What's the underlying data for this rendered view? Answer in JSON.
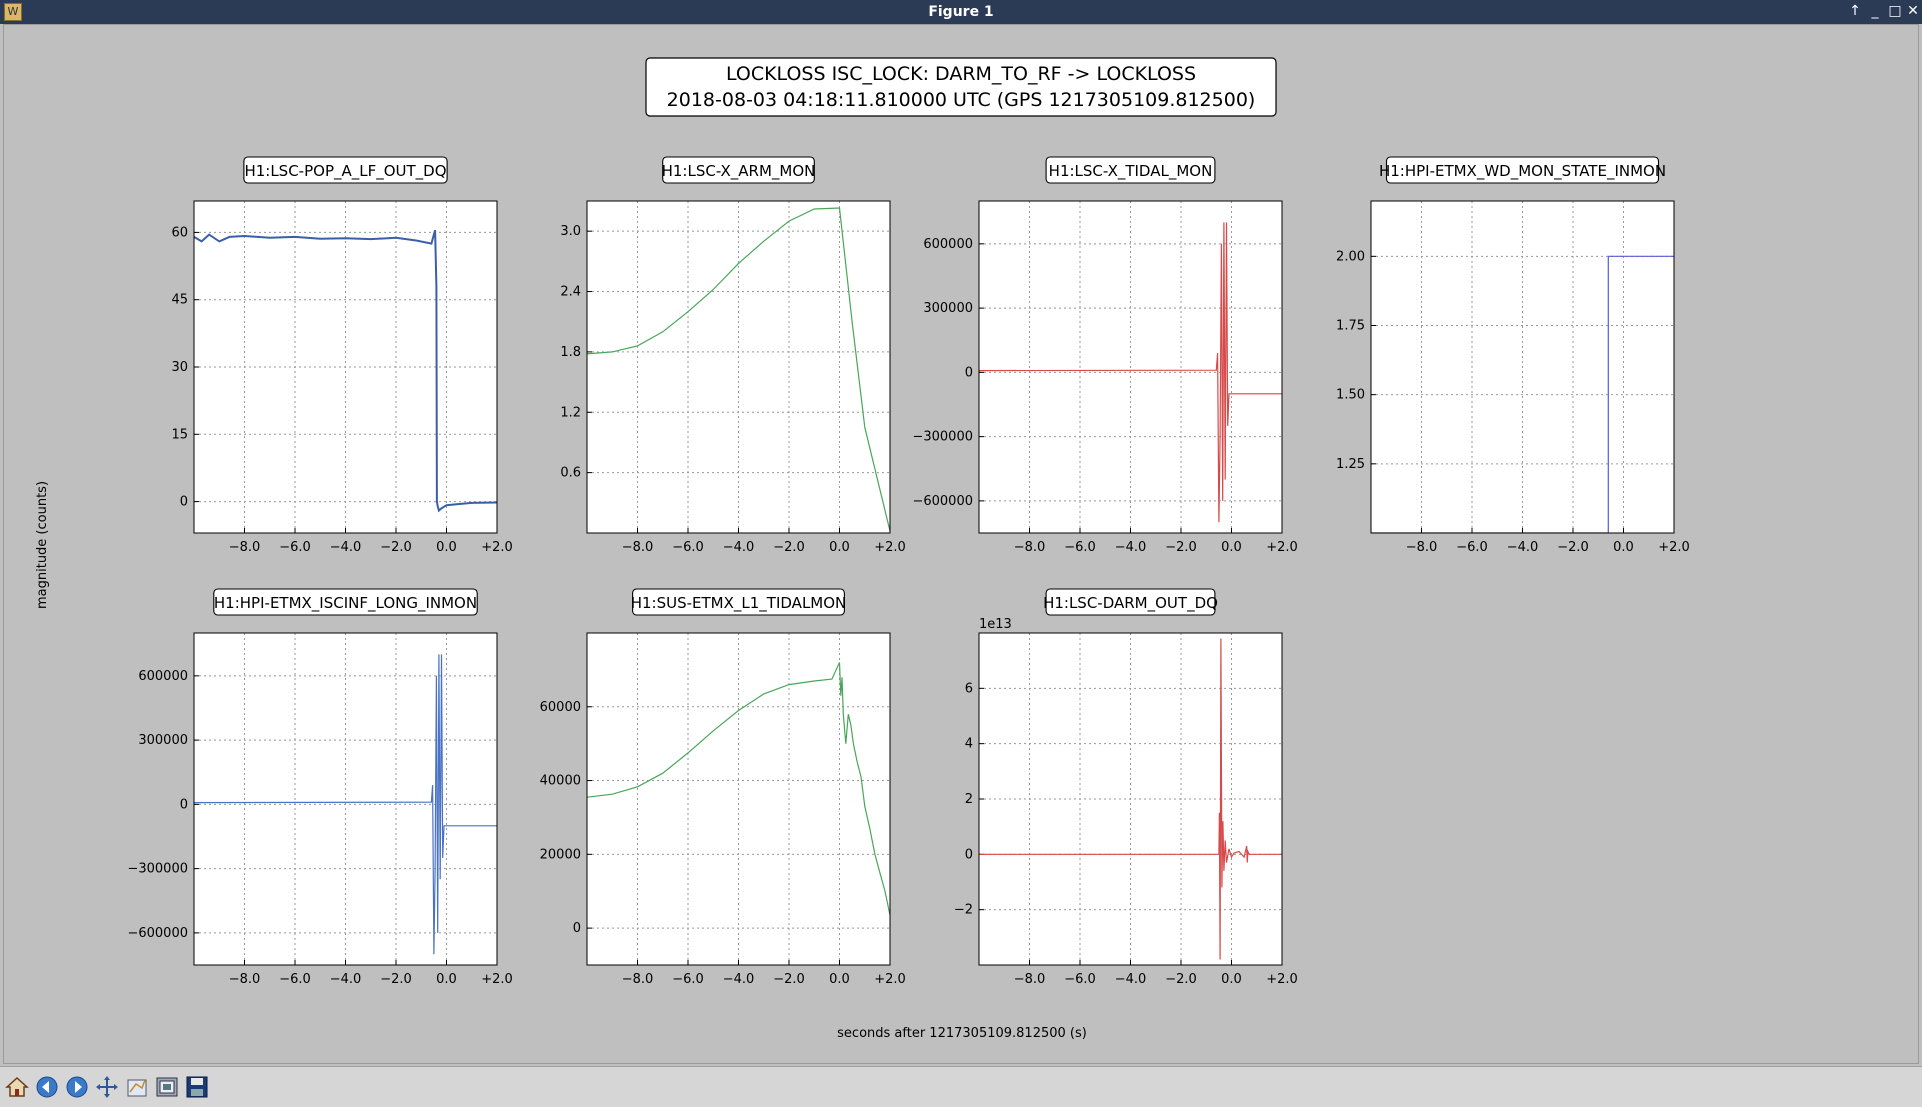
{
  "window": {
    "title": "Figure 1",
    "app_icon": "matplotlib-icon",
    "controls": [
      "up-arrow-icon",
      "minimize-icon",
      "maximize-icon",
      "close-icon"
    ]
  },
  "figure": {
    "title_line1": "LOCKLOSS ISC_LOCK: DARM_TO_RF -> LOCKLOSS",
    "title_line2": "2018-08-03 04:18:11.810000 UTC (GPS 1217305109.812500)",
    "ylabel": "magnitude (counts)",
    "xlabel": "seconds after 1217305109.812500 (s)"
  },
  "toolbar": {
    "buttons": [
      "home-icon",
      "back-icon",
      "forward-icon",
      "pan-icon",
      "configure-subplots-icon",
      "zoom-icon",
      "save-icon"
    ]
  },
  "chart_data": [
    {
      "type": "line",
      "title": "H1:LSC-POP_A_LF_OUT_DQ",
      "color": "#3a5fa8",
      "xlim": [
        -10,
        2
      ],
      "ylim": [
        -7,
        67
      ],
      "xticks": [
        "−8.0",
        "−6.0",
        "−4.0",
        "−2.0",
        "0.0",
        "+2.0"
      ],
      "yticks": [
        {
          "v": 60,
          "t": "60"
        },
        {
          "v": 45,
          "t": "45"
        },
        {
          "v": 30,
          "t": "30"
        },
        {
          "v": 15,
          "t": "15"
        },
        {
          "v": 0,
          "t": "0"
        }
      ],
      "series": [
        {
          "x": [
            -10,
            -9.7,
            -9.4,
            -9.0,
            -8.6,
            -8.0,
            -7.0,
            -6.0,
            -5.0,
            -4.0,
            -3.0,
            -2.0,
            -1.2,
            -0.6,
            -0.45,
            -0.4,
            -0.38,
            -0.35,
            -0.3,
            -0.2,
            0,
            0.4,
            1.0,
            2.0
          ],
          "y": [
            59,
            58,
            59.5,
            58,
            59,
            59.2,
            58.8,
            59,
            58.6,
            58.7,
            58.5,
            58.8,
            58.2,
            57.5,
            60.5,
            48,
            0,
            -1,
            -2,
            -1.5,
            -0.8,
            -0.6,
            -0.3,
            -0.2
          ]
        }
      ]
    },
    {
      "type": "line",
      "title": "H1:LSC-X_ARM_MON",
      "color": "#4aa55a",
      "xlim": [
        -10,
        2
      ],
      "ylim": [
        0,
        3.3
      ],
      "xticks": [
        "−8.0",
        "−6.0",
        "−4.0",
        "−2.0",
        "0.0",
        "+2.0"
      ],
      "yticks": [
        {
          "v": 3.0,
          "t": "3.0"
        },
        {
          "v": 2.4,
          "t": "2.4"
        },
        {
          "v": 1.8,
          "t": "1.8"
        },
        {
          "v": 1.2,
          "t": "1.2"
        },
        {
          "v": 0.6,
          "t": "0.6"
        }
      ],
      "series": [
        {
          "x": [
            -10,
            -9,
            -8,
            -7,
            -6,
            -5,
            -4,
            -3,
            -2,
            -1,
            0,
            0.5,
            1,
            2
          ],
          "y": [
            1.78,
            1.8,
            1.86,
            2.0,
            2.2,
            2.42,
            2.68,
            2.9,
            3.1,
            3.22,
            3.23,
            2.1,
            1.05,
            0.02
          ]
        }
      ]
    },
    {
      "type": "line",
      "title": "H1:LSC-X_TIDAL_MON",
      "color": "#d64a4a",
      "xlim": [
        -10,
        2
      ],
      "ylim": [
        -750000,
        800000
      ],
      "xticks": [
        "−8.0",
        "−6.0",
        "−4.0",
        "−2.0",
        "0.0",
        "+2.0"
      ],
      "yticks": [
        {
          "v": 600000,
          "t": "600000"
        },
        {
          "v": 300000,
          "t": "300000"
        },
        {
          "v": 0,
          "t": "0"
        },
        {
          "v": -300000,
          "t": "−300000"
        },
        {
          "v": -600000,
          "t": "−600000"
        }
      ],
      "series": [
        {
          "x": [
            -10,
            -0.6,
            -0.55,
            -0.5,
            -0.45,
            -0.4,
            -0.35,
            -0.3,
            -0.25,
            -0.2,
            -0.15,
            -0.1,
            -0.05,
            2
          ],
          "y": [
            8000,
            10000,
            90000,
            -700000,
            -300000,
            600000,
            -600000,
            700000,
            -500000,
            700000,
            -250000,
            -100000,
            -100000,
            -100000
          ]
        }
      ]
    },
    {
      "type": "line",
      "title": "H1:HPI-ETMX_WD_MON_STATE_INMON",
      "color": "#5a5ad6",
      "xlim": [
        -10,
        2
      ],
      "ylim": [
        1,
        2.2
      ],
      "xticks": [
        "−8.0",
        "−6.0",
        "−4.0",
        "−2.0",
        "0.0",
        "+2.0"
      ],
      "yticks": [
        {
          "v": 2.0,
          "t": "2.00"
        },
        {
          "v": 1.75,
          "t": "1.75"
        },
        {
          "v": 1.5,
          "t": "1.50"
        },
        {
          "v": 1.25,
          "t": "1.25"
        }
      ],
      "series": [
        {
          "x": [
            -10,
            -0.6,
            -0.6,
            2
          ],
          "y": [
            1,
            1,
            2,
            2
          ]
        }
      ]
    },
    {
      "type": "line",
      "title": "H1:HPI-ETMX_ISCINF_LONG_INMON",
      "color": "#4a72c4",
      "xlim": [
        -10,
        2
      ],
      "ylim": [
        -750000,
        800000
      ],
      "xticks": [
        "−8.0",
        "−6.0",
        "−4.0",
        "−2.0",
        "0.0",
        "+2.0"
      ],
      "yticks": [
        {
          "v": 600000,
          "t": "600000"
        },
        {
          "v": 300000,
          "t": "300000"
        },
        {
          "v": 0,
          "t": "0"
        },
        {
          "v": -300000,
          "t": "−300000"
        },
        {
          "v": -600000,
          "t": "−600000"
        }
      ],
      "series": [
        {
          "x": [
            -10,
            -0.6,
            -0.55,
            -0.5,
            -0.45,
            -0.4,
            -0.35,
            -0.3,
            -0.25,
            -0.2,
            -0.15,
            -0.1,
            2
          ],
          "y": [
            8000,
            10000,
            90000,
            -700000,
            -300000,
            600000,
            -600000,
            700000,
            -350000,
            700000,
            -250000,
            -100000,
            -100000
          ]
        }
      ]
    },
    {
      "type": "line",
      "title": "H1:SUS-ETMX_L1_TIDALMON",
      "color": "#4aa55a",
      "xlim": [
        -10,
        2
      ],
      "ylim": [
        -10000,
        80000
      ],
      "xticks": [
        "−8.0",
        "−6.0",
        "−4.0",
        "−2.0",
        "0.0",
        "+2.0"
      ],
      "yticks": [
        {
          "v": 60000,
          "t": "60000"
        },
        {
          "v": 40000,
          "t": "40000"
        },
        {
          "v": 20000,
          "t": "20000"
        },
        {
          "v": 0,
          "t": "0"
        }
      ],
      "series": [
        {
          "x": [
            -10,
            -9,
            -8,
            -7,
            -6,
            -5,
            -4,
            -3,
            -2,
            -1,
            -0.3,
            0,
            0.05,
            0.1,
            0.15,
            0.25,
            0.35,
            0.45,
            0.55,
            0.7,
            0.85,
            1.0,
            1.2,
            1.4,
            1.6,
            1.8,
            2
          ],
          "y": [
            35500,
            36300,
            38300,
            42000,
            47500,
            53500,
            59000,
            63500,
            66000,
            67000,
            67500,
            72000,
            63000,
            68000,
            58000,
            50000,
            58000,
            55000,
            50000,
            45000,
            41000,
            33000,
            27000,
            20000,
            15000,
            10000,
            3500
          ]
        }
      ]
    },
    {
      "type": "line",
      "title": "H1:LSC-DARM_OUT_DQ",
      "color": "#d64a4a",
      "offset_label": "1e13",
      "xlim": [
        -10,
        2
      ],
      "ylim": [
        -4,
        8
      ],
      "xticks": [
        "−8.0",
        "−6.0",
        "−4.0",
        "−2.0",
        "0.0",
        "+2.0"
      ],
      "yticks": [
        {
          "v": 6,
          "t": "6"
        },
        {
          "v": 4,
          "t": "4"
        },
        {
          "v": 2,
          "t": "2"
        },
        {
          "v": 0,
          "t": "0"
        },
        {
          "v": -2,
          "t": "−2"
        }
      ],
      "series": [
        {
          "x": [
            -10,
            -0.5,
            -0.48,
            -0.45,
            -0.42,
            -0.38,
            -0.34,
            -0.3,
            -0.25,
            -0.2,
            -0.1,
            0,
            0.1,
            0.3,
            0.5,
            0.6,
            0.62,
            0.65,
            0.7,
            2
          ],
          "y": [
            0,
            0,
            1.5,
            -3.8,
            7.8,
            -1.2,
            1.2,
            -0.6,
            0.5,
            -0.3,
            0.2,
            -0.1,
            0.05,
            0.1,
            -0.1,
            0.3,
            -0.3,
            0.1,
            0,
            0
          ]
        }
      ]
    }
  ]
}
